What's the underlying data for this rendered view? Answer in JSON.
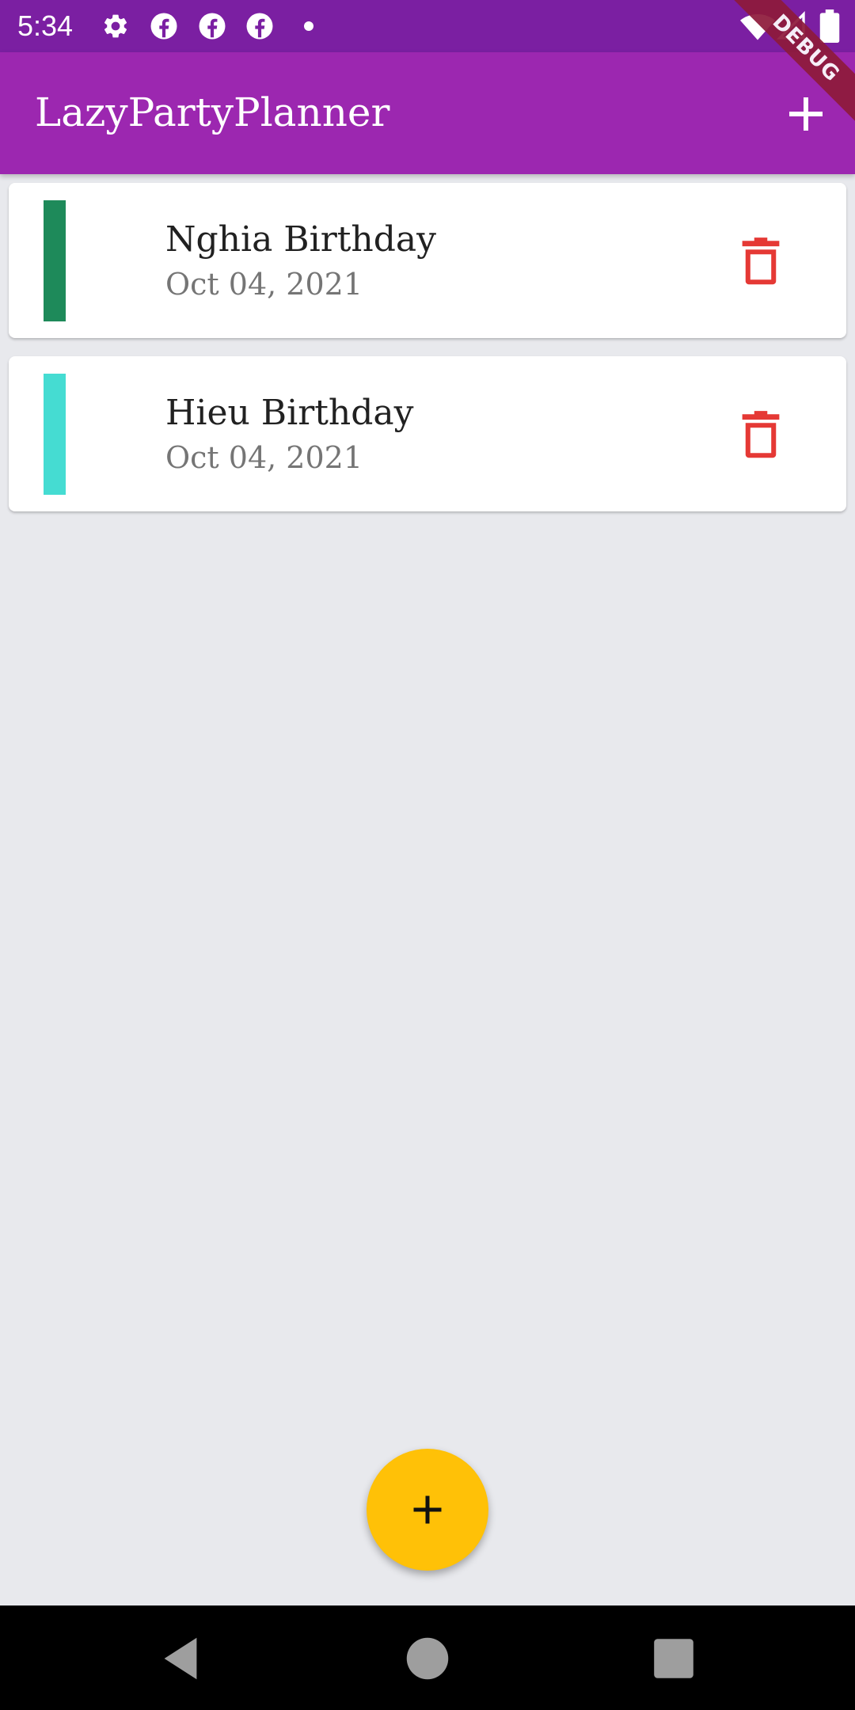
{
  "status_bar": {
    "time": "5:34",
    "icons": [
      "gear-icon",
      "facebook-icon",
      "facebook-icon",
      "facebook-icon",
      "dot-icon",
      "wifi-icon",
      "signal-icon",
      "battery-icon"
    ],
    "debug_banner": "DEBUG"
  },
  "app_bar": {
    "title": "LazyPartyPlanner",
    "action_icon": "plus-icon"
  },
  "events": [
    {
      "title": "Nghia Birthday",
      "date": "Oct 04, 2021",
      "color": "#1e8a5a",
      "action_icon": "trash-icon"
    },
    {
      "title": "Hieu Birthday",
      "date": "Oct 04, 2021",
      "color": "#45dcd2",
      "action_icon": "trash-icon"
    }
  ],
  "fab": {
    "icon": "plus-icon"
  },
  "nav_bar": {
    "buttons": [
      "back-icon",
      "home-icon",
      "recents-icon"
    ]
  },
  "colors": {
    "status_bar": "#7b1fa2",
    "app_bar": "#9c27b0",
    "background": "#e8e9ed",
    "fab": "#ffc107",
    "delete": "#e53935",
    "debug_ribbon": "#8e1a3a"
  }
}
